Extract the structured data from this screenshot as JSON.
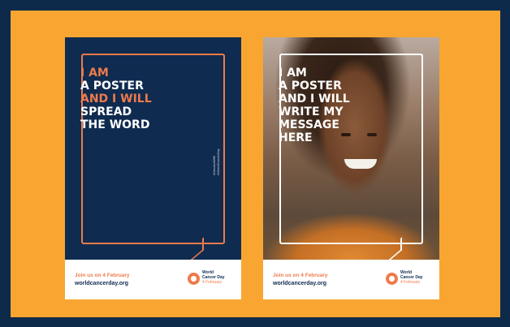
{
  "posters": [
    {
      "headline": [
        {
          "text": "I AM",
          "highlight": true
        },
        {
          "text": "A POSTER",
          "highlight": false
        },
        {
          "text": "AND I WILL",
          "highlight": true
        },
        {
          "text": "SPREAD",
          "highlight": false
        },
        {
          "text": "THE WORD",
          "highlight": false
        }
      ],
      "vertical_text": [
        "#IAmAndIWill",
        "#WorldCancerDay"
      ],
      "footer": {
        "join": "Join us on 4 February",
        "url": "worldcancerday.org",
        "logo": {
          "line1": "World",
          "line2": "Cancer Day",
          "line3": "4 February"
        }
      }
    },
    {
      "headline": [
        {
          "text": "I AM",
          "highlight": false
        },
        {
          "text": "A POSTER",
          "highlight": false
        },
        {
          "text": "AND I WILL",
          "highlight": false
        },
        {
          "text": "WRITE MY",
          "highlight": false
        },
        {
          "text": "MESSAGE",
          "highlight": false
        },
        {
          "text": "HERE",
          "highlight": false
        }
      ],
      "footer": {
        "join": "Join us on 4 February",
        "url": "worldcancerday.org",
        "logo": {
          "line1": "World",
          "line2": "Cancer Day",
          "line3": "4 February"
        }
      }
    }
  ],
  "colors": {
    "background": "#0d2a4a",
    "frame": "#f8a631",
    "poster_navy": "#0f2b50",
    "accent_orange": "#ee7b4a"
  }
}
